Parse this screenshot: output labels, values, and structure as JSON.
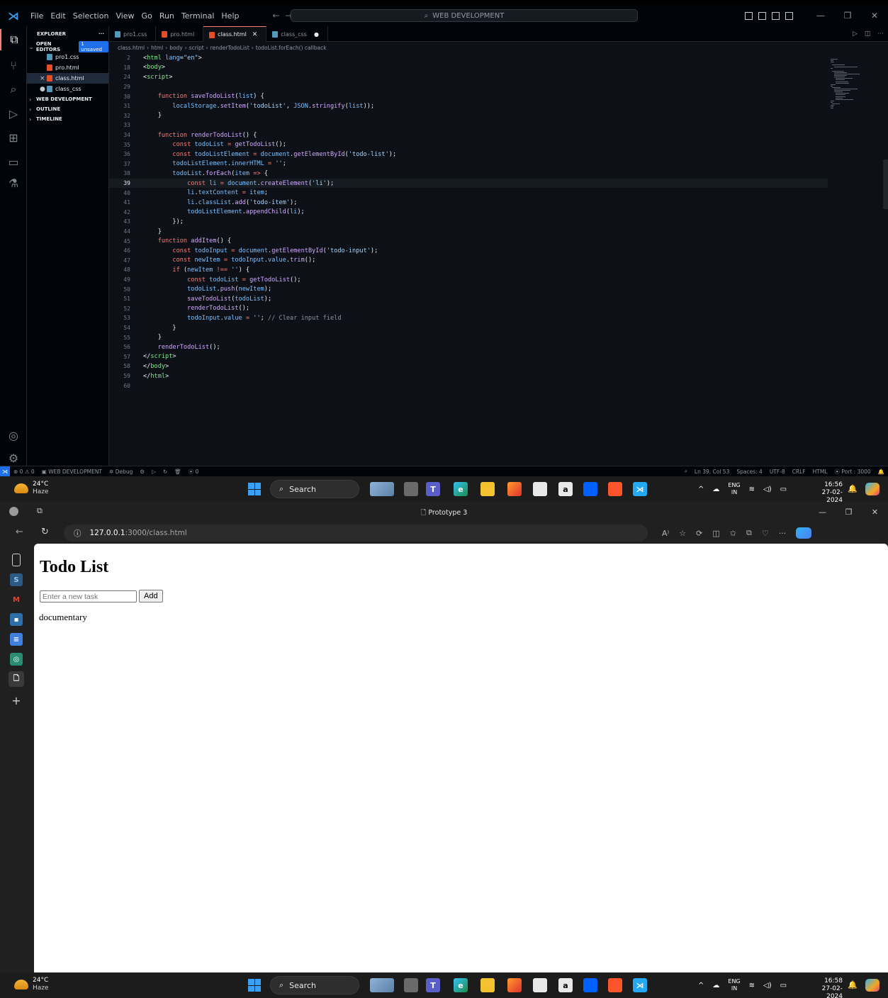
{
  "vscode": {
    "menu": [
      "File",
      "Edit",
      "Selection",
      "View",
      "Go",
      "Run",
      "Terminal",
      "Help"
    ],
    "search_label": "WEB DEVELOPMENT",
    "explorer": {
      "title": "EXPLORER",
      "more": "···",
      "open_editors": "OPEN EDITORS",
      "unsaved_badge": "1 unsaved",
      "files": [
        {
          "name": "pro1.css",
          "type": "css",
          "mark": ""
        },
        {
          "name": "pro.html",
          "type": "html",
          "mark": ""
        },
        {
          "name": "class.html",
          "type": "html",
          "mark": "×"
        },
        {
          "name": "class_css",
          "type": "css",
          "mark": "●"
        }
      ],
      "sections": [
        "WEB DEVELOPMENT",
        "OUTLINE",
        "TIMELINE"
      ]
    },
    "tabs": [
      {
        "name": "pro1.css",
        "type": "css"
      },
      {
        "name": "pro.html",
        "type": "html"
      },
      {
        "name": "class.html",
        "type": "html"
      },
      {
        "name": "class_css",
        "type": "css"
      }
    ],
    "breadcrumb": [
      "class.html",
      "html",
      "body",
      "script",
      "renderTodoList",
      "todoList.forEach() callback"
    ],
    "lines": [
      {
        "n": "2",
        "tokens": [
          [
            "p",
            "<"
          ],
          [
            "t",
            "html"
          ],
          [
            "p",
            " "
          ],
          [
            "v",
            "lang"
          ],
          [
            "p",
            "="
          ],
          [
            "s",
            "\"en\""
          ],
          [
            "p",
            ">"
          ]
        ]
      },
      {
        "n": "18",
        "tokens": [
          [
            "p",
            "<"
          ],
          [
            "t",
            "body"
          ],
          [
            "p",
            ">"
          ]
        ]
      },
      {
        "n": "24",
        "tokens": [
          [
            "p",
            "<"
          ],
          [
            "t",
            "script"
          ],
          [
            "p",
            ">"
          ]
        ]
      },
      {
        "n": "29",
        "tokens": []
      },
      {
        "n": "30",
        "tokens": [
          [
            "p",
            "    "
          ],
          [
            "k",
            "function"
          ],
          [
            "p",
            " "
          ],
          [
            "f",
            "saveTodoList"
          ],
          [
            "p",
            "("
          ],
          [
            "v",
            "list"
          ],
          [
            "p",
            ") {"
          ]
        ]
      },
      {
        "n": "31",
        "tokens": [
          [
            "p",
            "        "
          ],
          [
            "v",
            "localStorage"
          ],
          [
            "p",
            "."
          ],
          [
            "f",
            "setItem"
          ],
          [
            "p",
            "("
          ],
          [
            "s",
            "'todoList'"
          ],
          [
            "p",
            ", "
          ],
          [
            "v",
            "JSON"
          ],
          [
            "p",
            "."
          ],
          [
            "f",
            "stringify"
          ],
          [
            "p",
            "("
          ],
          [
            "v",
            "list"
          ],
          [
            "p",
            "));"
          ]
        ]
      },
      {
        "n": "32",
        "tokens": [
          [
            "p",
            "    }"
          ]
        ]
      },
      {
        "n": "33",
        "tokens": []
      },
      {
        "n": "34",
        "tokens": [
          [
            "p",
            "    "
          ],
          [
            "k",
            "function"
          ],
          [
            "p",
            " "
          ],
          [
            "f",
            "renderTodoList"
          ],
          [
            "p",
            "() {"
          ]
        ]
      },
      {
        "n": "35",
        "tokens": [
          [
            "p",
            "        "
          ],
          [
            "k",
            "const"
          ],
          [
            "p",
            " "
          ],
          [
            "v",
            "todoList"
          ],
          [
            "p",
            " "
          ],
          [
            "k",
            "="
          ],
          [
            "p",
            " "
          ],
          [
            "f",
            "getTodoList"
          ],
          [
            "p",
            "();"
          ]
        ]
      },
      {
        "n": "36",
        "tokens": [
          [
            "p",
            "        "
          ],
          [
            "k",
            "const"
          ],
          [
            "p",
            " "
          ],
          [
            "v",
            "todoListElement"
          ],
          [
            "p",
            " "
          ],
          [
            "k",
            "="
          ],
          [
            "p",
            " "
          ],
          [
            "v",
            "document"
          ],
          [
            "p",
            "."
          ],
          [
            "f",
            "getElementById"
          ],
          [
            "p",
            "("
          ],
          [
            "s",
            "'todo-list'"
          ],
          [
            "p",
            ");"
          ]
        ]
      },
      {
        "n": "37",
        "tokens": [
          [
            "p",
            "        "
          ],
          [
            "v",
            "todoListElement"
          ],
          [
            "p",
            "."
          ],
          [
            "v",
            "innerHTML"
          ],
          [
            "p",
            " "
          ],
          [
            "k",
            "="
          ],
          [
            "p",
            " "
          ],
          [
            "s",
            "''"
          ],
          [
            "p",
            ";"
          ]
        ]
      },
      {
        "n": "38",
        "tokens": [
          [
            "p",
            "        "
          ],
          [
            "v",
            "todoList"
          ],
          [
            "p",
            "."
          ],
          [
            "f",
            "forEach"
          ],
          [
            "p",
            "("
          ],
          [
            "v",
            "item"
          ],
          [
            "p",
            " "
          ],
          [
            "k",
            "=>"
          ],
          [
            "p",
            " {"
          ]
        ]
      },
      {
        "n": "39",
        "tokens": [
          [
            "p",
            "            "
          ],
          [
            "k",
            "const"
          ],
          [
            "p",
            " "
          ],
          [
            "v",
            "li"
          ],
          [
            "p",
            " "
          ],
          [
            "k",
            "="
          ],
          [
            "p",
            " "
          ],
          [
            "v",
            "document"
          ],
          [
            "p",
            "."
          ],
          [
            "f",
            "createElement"
          ],
          [
            "p",
            "("
          ],
          [
            "s",
            "'li'"
          ],
          [
            "p",
            ");"
          ]
        ]
      },
      {
        "n": "40",
        "tokens": [
          [
            "p",
            "            "
          ],
          [
            "v",
            "li"
          ],
          [
            "p",
            "."
          ],
          [
            "v",
            "textContent"
          ],
          [
            "p",
            " "
          ],
          [
            "k",
            "="
          ],
          [
            "p",
            " "
          ],
          [
            "v",
            "item"
          ],
          [
            "p",
            ";"
          ]
        ]
      },
      {
        "n": "41",
        "tokens": [
          [
            "p",
            "            "
          ],
          [
            "v",
            "li"
          ],
          [
            "p",
            "."
          ],
          [
            "v",
            "classList"
          ],
          [
            "p",
            "."
          ],
          [
            "f",
            "add"
          ],
          [
            "p",
            "("
          ],
          [
            "s",
            "'todo-item'"
          ],
          [
            "p",
            ");"
          ]
        ]
      },
      {
        "n": "42",
        "tokens": [
          [
            "p",
            "            "
          ],
          [
            "v",
            "todoListElement"
          ],
          [
            "p",
            "."
          ],
          [
            "f",
            "appendChild"
          ],
          [
            "p",
            "("
          ],
          [
            "v",
            "li"
          ],
          [
            "p",
            ");"
          ]
        ]
      },
      {
        "n": "43",
        "tokens": [
          [
            "p",
            "        });"
          ]
        ]
      },
      {
        "n": "44",
        "tokens": [
          [
            "p",
            "    }"
          ]
        ]
      },
      {
        "n": "45",
        "tokens": [
          [
            "p",
            "    "
          ],
          [
            "k",
            "function"
          ],
          [
            "p",
            " "
          ],
          [
            "f",
            "addItem"
          ],
          [
            "p",
            "() {"
          ]
        ]
      },
      {
        "n": "46",
        "tokens": [
          [
            "p",
            "        "
          ],
          [
            "k",
            "const"
          ],
          [
            "p",
            " "
          ],
          [
            "v",
            "todoInput"
          ],
          [
            "p",
            " "
          ],
          [
            "k",
            "="
          ],
          [
            "p",
            " "
          ],
          [
            "v",
            "document"
          ],
          [
            "p",
            "."
          ],
          [
            "f",
            "getElementById"
          ],
          [
            "p",
            "("
          ],
          [
            "s",
            "'todo-input'"
          ],
          [
            "p",
            ");"
          ]
        ]
      },
      {
        "n": "47",
        "tokens": [
          [
            "p",
            "        "
          ],
          [
            "k",
            "const"
          ],
          [
            "p",
            " "
          ],
          [
            "v",
            "newItem"
          ],
          [
            "p",
            " "
          ],
          [
            "k",
            "="
          ],
          [
            "p",
            " "
          ],
          [
            "v",
            "todoInput"
          ],
          [
            "p",
            "."
          ],
          [
            "v",
            "value"
          ],
          [
            "p",
            "."
          ],
          [
            "f",
            "trim"
          ],
          [
            "p",
            "();"
          ]
        ]
      },
      {
        "n": "48",
        "tokens": [
          [
            "p",
            "        "
          ],
          [
            "k",
            "if"
          ],
          [
            "p",
            " ("
          ],
          [
            "v",
            "newItem"
          ],
          [
            "p",
            " "
          ],
          [
            "k",
            "!=="
          ],
          [
            "p",
            " "
          ],
          [
            "s",
            "''"
          ],
          [
            "p",
            ") {"
          ]
        ]
      },
      {
        "n": "49",
        "tokens": [
          [
            "p",
            "            "
          ],
          [
            "k",
            "const"
          ],
          [
            "p",
            " "
          ],
          [
            "v",
            "todoList"
          ],
          [
            "p",
            " "
          ],
          [
            "k",
            "="
          ],
          [
            "p",
            " "
          ],
          [
            "f",
            "getTodoList"
          ],
          [
            "p",
            "();"
          ]
        ]
      },
      {
        "n": "50",
        "tokens": [
          [
            "p",
            "            "
          ],
          [
            "v",
            "todoList"
          ],
          [
            "p",
            "."
          ],
          [
            "f",
            "push"
          ],
          [
            "p",
            "("
          ],
          [
            "v",
            "newItem"
          ],
          [
            "p",
            ");"
          ]
        ]
      },
      {
        "n": "51",
        "tokens": [
          [
            "p",
            "            "
          ],
          [
            "f",
            "saveTodoList"
          ],
          [
            "p",
            "("
          ],
          [
            "v",
            "todoList"
          ],
          [
            "p",
            ");"
          ]
        ]
      },
      {
        "n": "52",
        "tokens": [
          [
            "p",
            "            "
          ],
          [
            "f",
            "renderTodoList"
          ],
          [
            "p",
            "();"
          ]
        ]
      },
      {
        "n": "53",
        "tokens": [
          [
            "p",
            "            "
          ],
          [
            "v",
            "todoInput"
          ],
          [
            "p",
            "."
          ],
          [
            "v",
            "value"
          ],
          [
            "p",
            " "
          ],
          [
            "k",
            "="
          ],
          [
            "p",
            " "
          ],
          [
            "s",
            "''"
          ],
          [
            "p",
            "; "
          ],
          [
            "c",
            "// Clear input field"
          ]
        ]
      },
      {
        "n": "54",
        "tokens": [
          [
            "p",
            "        }"
          ]
        ]
      },
      {
        "n": "55",
        "tokens": [
          [
            "p",
            "    }"
          ]
        ]
      },
      {
        "n": "56",
        "tokens": [
          [
            "p",
            "    "
          ],
          [
            "f",
            "renderTodoList"
          ],
          [
            "p",
            "();"
          ]
        ]
      },
      {
        "n": "57",
        "tokens": [
          [
            "p",
            "</"
          ],
          [
            "t",
            "script"
          ],
          [
            "p",
            ">"
          ]
        ]
      },
      {
        "n": "58",
        "tokens": [
          [
            "p",
            "</"
          ],
          [
            "t",
            "body"
          ],
          [
            "p",
            ">"
          ]
        ]
      },
      {
        "n": "59",
        "tokens": [
          [
            "p",
            "</"
          ],
          [
            "t",
            "html"
          ],
          [
            "p",
            ">"
          ]
        ]
      },
      {
        "n": "60",
        "tokens": []
      }
    ],
    "current_line": "39",
    "status_left": {
      "problems": "⊗ 0 ⚠ 0",
      "workspace": "WEB DEVELOPMENT",
      "debug": "Debug",
      "ports": "0"
    },
    "status_right": {
      "position": "Ln 39, Col 53",
      "spaces": "Spaces: 4",
      "encoding": "UTF-8",
      "eol": "CRLF",
      "language": "HTML",
      "port": "Port : 3000"
    }
  },
  "taskbars": [
    {
      "temp": "24°C",
      "cond": "Haze",
      "search": "Search",
      "lang_top": "ENG",
      "lang_bottom": "IN",
      "time": "16:56",
      "date": "27-02-2024"
    },
    {
      "temp": "24°C",
      "cond": "Haze",
      "search": "Search",
      "lang_top": "ENG",
      "lang_bottom": "IN",
      "time": "16:58",
      "date": "27-02-2024"
    }
  ],
  "browser": {
    "tab_title": "Prototype 3",
    "url_host": "127.0.0.1",
    "url_path": ":3000/class.html",
    "page": {
      "heading": "Todo List",
      "input_placeholder": "Enter a new task",
      "add_label": "Add",
      "items": [
        "documentary"
      ]
    }
  },
  "colors": {
    "vscode_bg": "#0d1117",
    "accent": "#1f6feb",
    "taskbar_bg": "#1c1c1c",
    "browser_chrome": "#202020"
  }
}
